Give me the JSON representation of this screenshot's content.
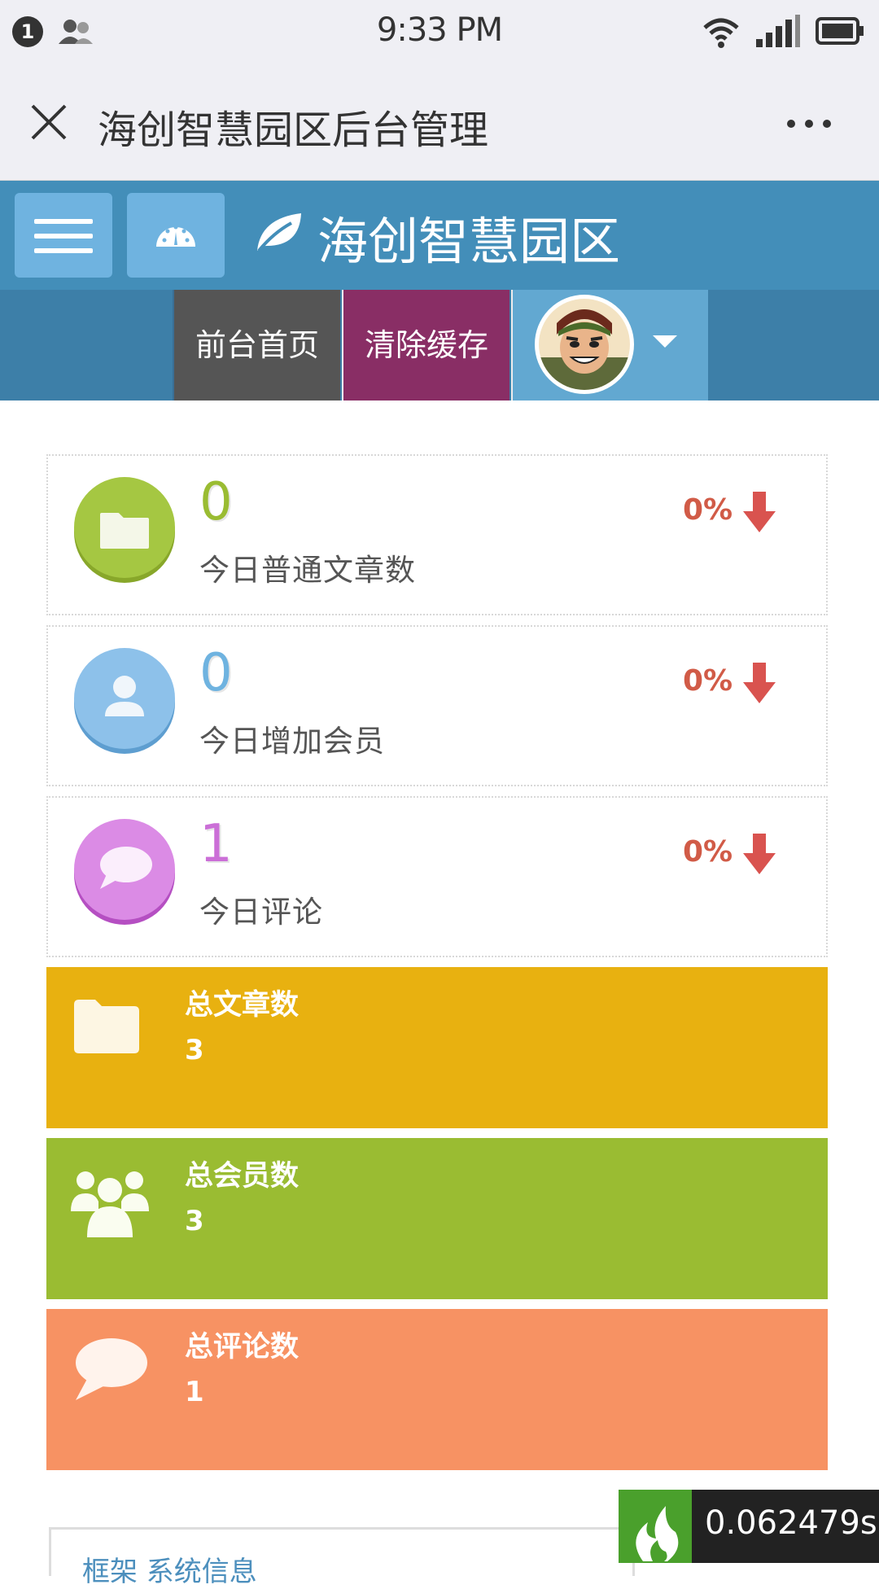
{
  "status_bar": {
    "notification_count": "1",
    "time": "9:33 PM"
  },
  "title_bar": {
    "title": "海创智慧园区后台管理"
  },
  "header": {
    "brand": "海创智慧园区",
    "nav": {
      "home": "前台首页",
      "clear_cache": "清除缓存"
    }
  },
  "infoboxes": [
    {
      "value": "0",
      "label": "今日普通文章数",
      "percent": "0%",
      "color": "#9abc32",
      "icon": "folder-icon"
    },
    {
      "value": "0",
      "label": "今日增加会员",
      "percent": "0%",
      "color": "#6fb3e0",
      "icon": "user-icon"
    },
    {
      "value": "1",
      "label": "今日评论",
      "percent": "0%",
      "color": "#cb6fd7",
      "icon": "comment-icon"
    }
  ],
  "stat_boxes": [
    {
      "label": "总文章数",
      "value": "3",
      "color": "#e8b110",
      "icon": "folder-icon"
    },
    {
      "label": "总会员数",
      "value": "3",
      "color": "#9abc32",
      "icon": "users-icon"
    },
    {
      "label": "总评论数",
      "value": "1",
      "color": "#f79263",
      "icon": "comment-icon"
    }
  ],
  "bottom": {
    "panel_title": "框架 系统信息",
    "timer": "0.062479s"
  }
}
